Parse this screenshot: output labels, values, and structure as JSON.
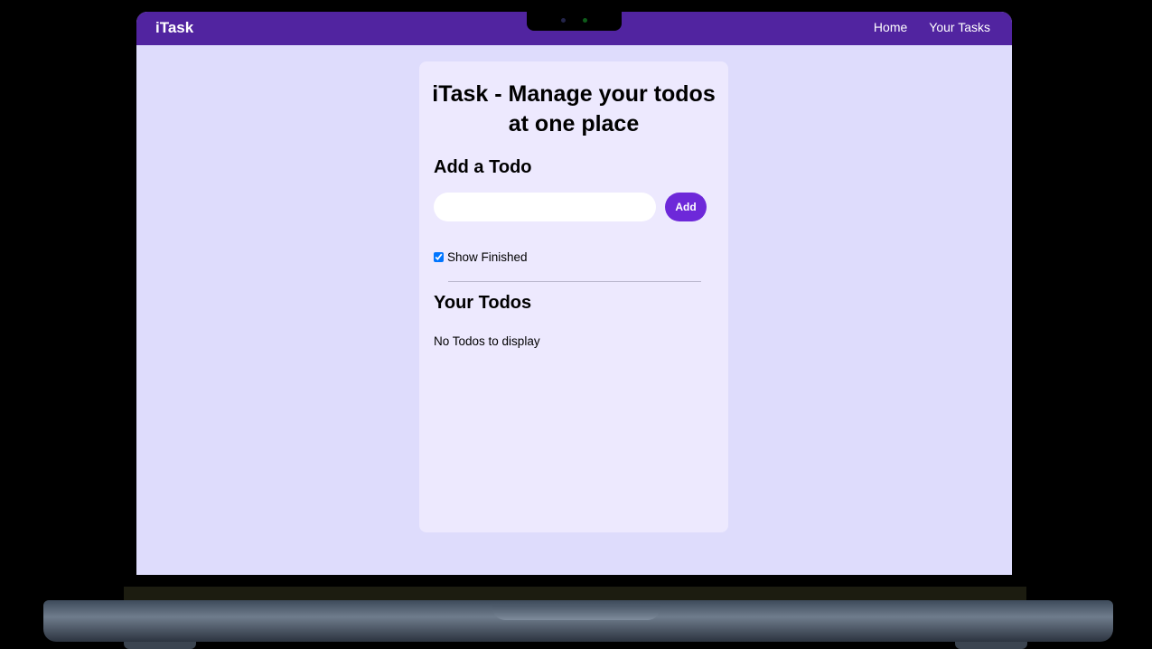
{
  "navbar": {
    "brand": "iTask",
    "links": [
      "Home",
      "Your Tasks"
    ]
  },
  "card": {
    "title": "iTask - Manage your todos at one place",
    "add_heading": "Add a Todo",
    "input_value": "",
    "add_button": "Add",
    "show_finished_label": "Show Finished",
    "show_finished_checked": true,
    "todos_heading": "Your Todos",
    "empty_message": "No Todos to display"
  },
  "colors": {
    "navbar": "#5124a0",
    "page_background": "#dedcfc",
    "card_background": "#ede9fe",
    "accent": "#6d28d9"
  }
}
